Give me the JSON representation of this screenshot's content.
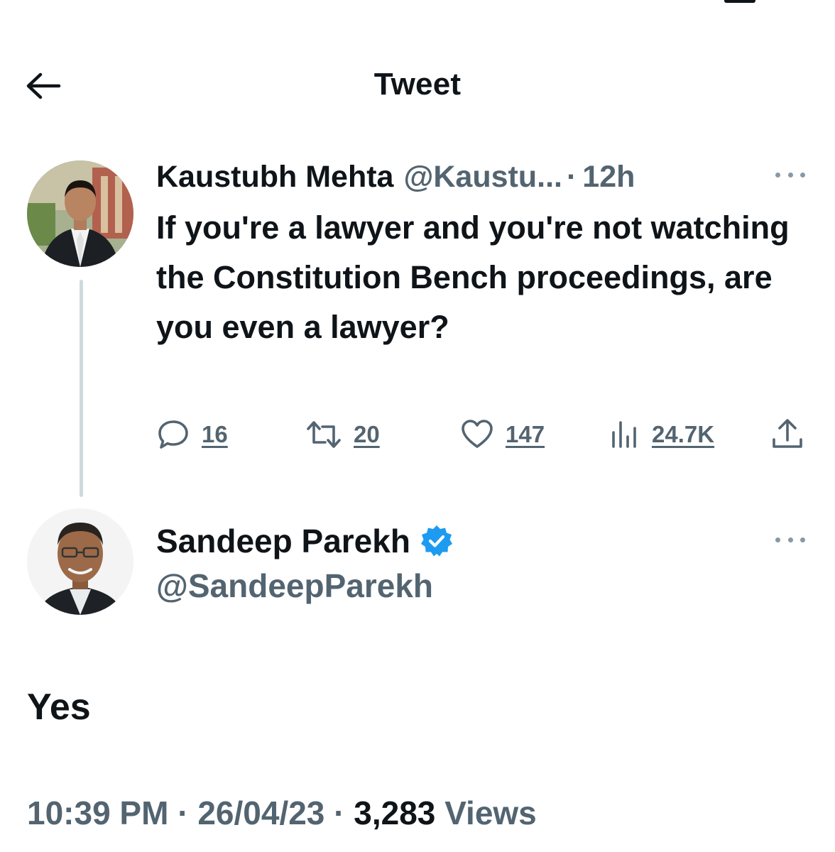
{
  "header": {
    "title": "Tweet",
    "back_icon": "arrow-left-icon"
  },
  "parent_tweet": {
    "author_name": "Kaustubh Mehta",
    "author_handle": "@Kaustu...",
    "separator": "·",
    "time": "12h",
    "text": "If you're a lawyer and you're not watching the Constitution Bench proceedings, are you even a lawyer?",
    "actions": {
      "replies": "16",
      "retweets": "20",
      "likes": "147",
      "views": "24.7K"
    }
  },
  "reply_tweet": {
    "author_name": "Sandeep Parekh",
    "verified": true,
    "author_handle": "@SandeepParekh",
    "text": "Yes",
    "timestamp": "10:39 PM",
    "date": "26/04/23",
    "separator": "·",
    "views_count": "3,283",
    "views_label": "Views"
  },
  "colors": {
    "text_primary": "#0f1419",
    "text_secondary": "#536471",
    "verified_blue": "#1d9bf0",
    "thread_line": "#cfd9de"
  }
}
